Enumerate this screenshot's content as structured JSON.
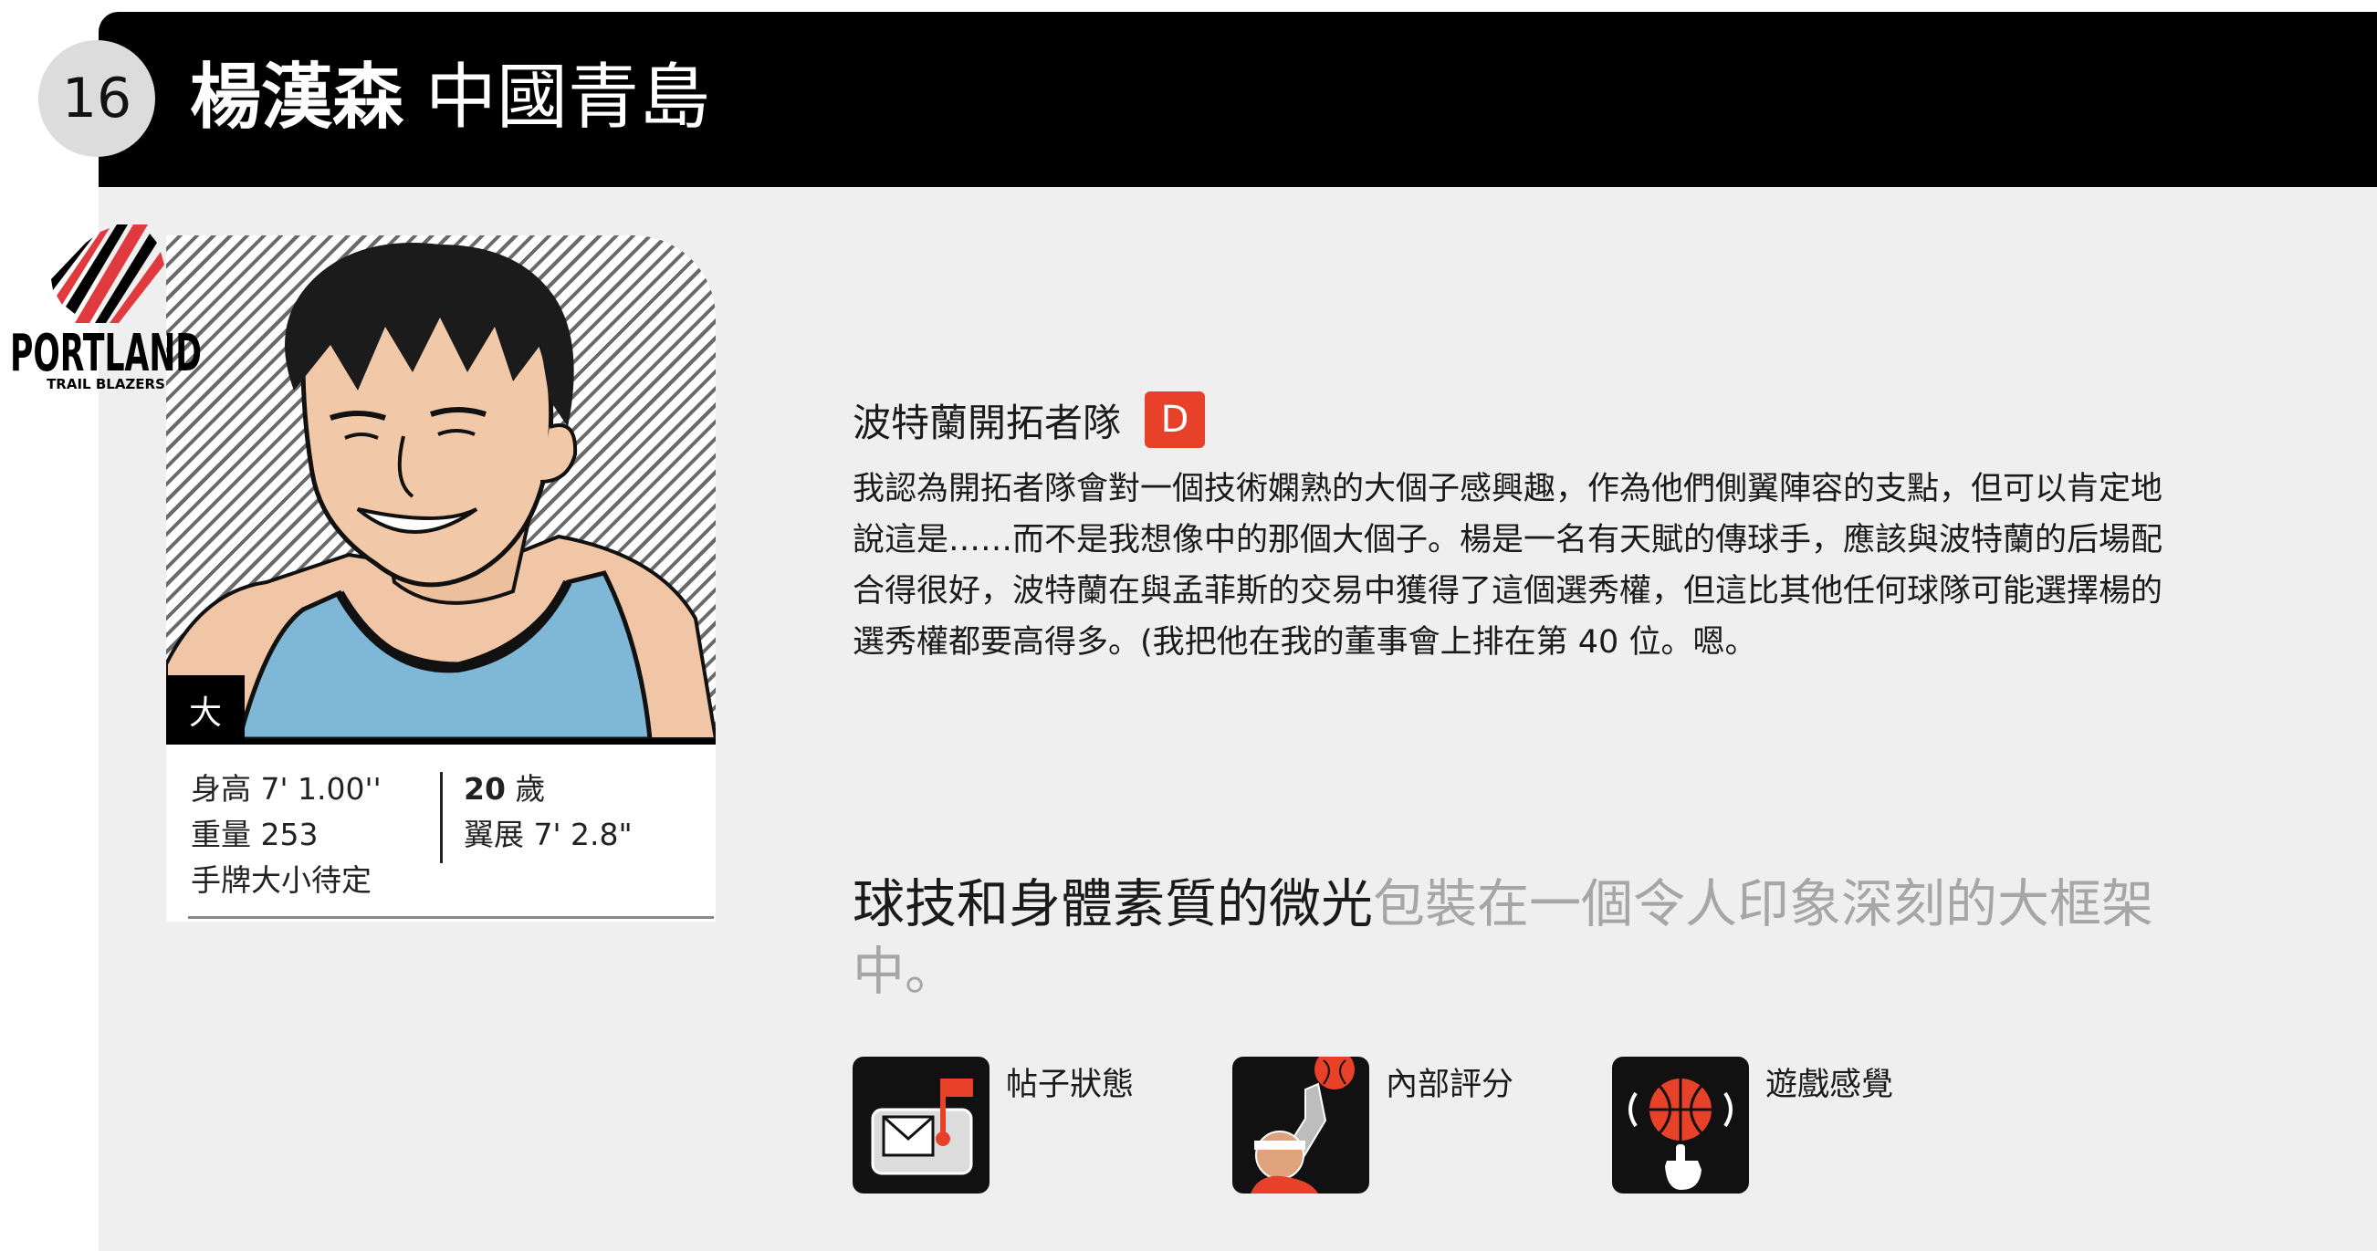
{
  "header": {
    "pick_number": "16",
    "player_name": "楊漢森",
    "origin": "中國青島"
  },
  "team_logo": {
    "wordmark": "PORTLAND",
    "subtitle": "TRAIL BLAZERS",
    "colors": {
      "red": "#e03a3e",
      "black": "#000000"
    }
  },
  "card": {
    "size_badge": "大",
    "height": "身高 7' 1.00''",
    "weight": "重量 253",
    "hand_size": "手牌大小待定",
    "age_number": "20",
    "age_unit": " 歲",
    "wingspan": "翼展 7' 2.8\""
  },
  "report": {
    "team": "波特蘭開拓者隊",
    "grade": "D",
    "text": "我認為開拓者隊會對一個技術嫻熟的大個子感興趣，作為他們側翼陣容的支點，但可以肯定地說這是……而不是我想像中的那個大個子。楊是一名有天賦的傳球手，應該與波特蘭的后場配合得很好，波特蘭在與孟菲斯的交易中獲得了這個選秀權，但這比其他任何球隊可能選擇楊的選秀權都要高得多。(我把他在我的董事會上排在第 40 位。嗯。"
  },
  "headline": {
    "strong": "球技和身體素質的微光",
    "muted": "包裝在一個令人印象深刻的大框架中。"
  },
  "tags": [
    {
      "label": "帖子狀態",
      "icon": "mailbox-icon"
    },
    {
      "label": "內部評分",
      "icon": "dunk-icon"
    },
    {
      "label": "遊戲感覺",
      "icon": "spinning-ball-icon"
    }
  ],
  "colors": {
    "accent": "#e8412a",
    "jersey": "#7fb8d6",
    "panel": "#efefef",
    "header": "#000000"
  }
}
